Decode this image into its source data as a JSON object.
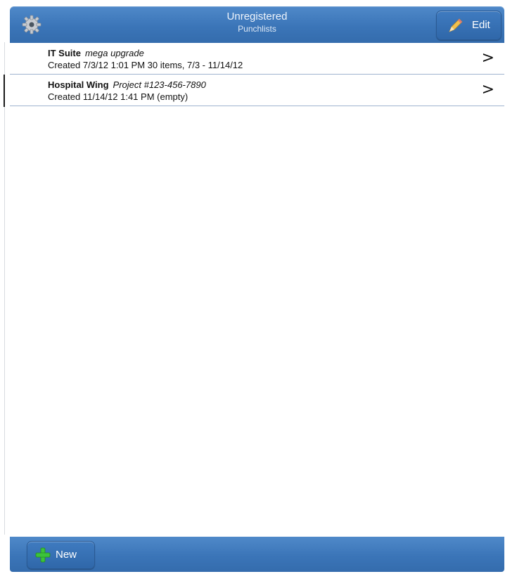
{
  "header": {
    "title": "Unregistered",
    "subtitle": "Punchlists",
    "settings_icon": "gear-icon",
    "edit_label": "Edit",
    "edit_icon": "pencil-icon"
  },
  "punchlists": [
    {
      "name": "IT Suite",
      "note": "mega upgrade",
      "detail": "Created 7/3/12 1:01 PM  30 items, 7/3 - 11/14/12",
      "chevron": ">"
    },
    {
      "name": "Hospital Wing",
      "note": "Project #123-456-7890",
      "detail": "Created 11/14/12 1:41 PM  (empty)",
      "chevron": ">"
    }
  ],
  "footer": {
    "new_label": "New",
    "new_icon": "plus-icon"
  },
  "colors": {
    "bar": "#3b75b8",
    "row_divider": "#9fb4cf",
    "plus_green": "#3cc23a"
  }
}
